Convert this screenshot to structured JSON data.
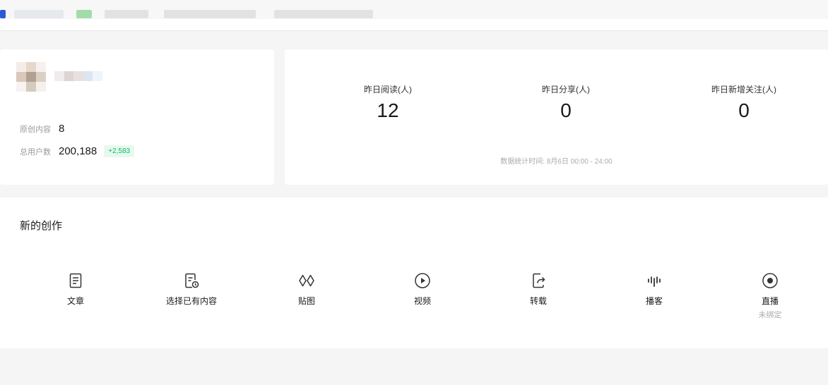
{
  "profile": {
    "original_label": "原创内容",
    "original_value": "8",
    "users_label": "总用户数",
    "users_value": "200,188",
    "users_delta": "+2,583"
  },
  "stats": {
    "items": [
      {
        "label": "昨日阅读(人)",
        "value": "12"
      },
      {
        "label": "昨日分享(人)",
        "value": "0"
      },
      {
        "label": "昨日新增关注(人)",
        "value": "0"
      }
    ],
    "time_note": "数据统计时间: 8月6日 00:00 - 24:00"
  },
  "create": {
    "title": "新的创作",
    "tools": [
      {
        "label": "文章",
        "icon": "article-icon"
      },
      {
        "label": "选择已有内容",
        "icon": "select-existing-icon"
      },
      {
        "label": "贴图",
        "icon": "image-post-icon"
      },
      {
        "label": "视频",
        "icon": "video-icon"
      },
      {
        "label": "转载",
        "icon": "repost-icon"
      },
      {
        "label": "播客",
        "icon": "podcast-icon"
      },
      {
        "label": "直播",
        "icon": "live-icon",
        "sub": "未绑定"
      }
    ]
  }
}
